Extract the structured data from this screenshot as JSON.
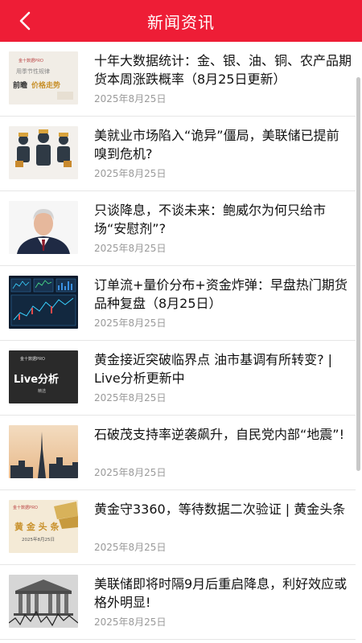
{
  "header": {
    "title": "新闻资讯",
    "back_icon": "chevron-left-icon",
    "color": "#ee1d36"
  },
  "news": [
    {
      "title": "十年大数据统计：金、银、油、铜、农产品期货本周涨跌概率（8月25日更新）",
      "date": "2025年8月25日",
      "thumb": {
        "brand": "金十数据PRO",
        "line1": "用季节性规律",
        "line2": "前瞻",
        "line3": "价格走势"
      }
    },
    {
      "title": "美就业市场陷入“诡异”僵局，美联储已提前嗅到危机?",
      "date": "2025年8月25日"
    },
    {
      "title": "只谈降息，不谈未来：鲍威尔为何只给市场“安慰剂”?",
      "date": "2025年8月25日"
    },
    {
      "title": "订单流+量价分布+资金炸弹：早盘热门期货品种复盘（8月25日）",
      "date": "2025年8月25日"
    },
    {
      "title": "黄金接近突破临界点 油市基调有所转变? | Live分析更新中",
      "date": "2025年8月25日",
      "thumb": {
        "brand": "金十数据PRO",
        "main": "Live分析",
        "sub": "精选"
      }
    },
    {
      "title": "石破茂支持率逆袭飙升，自民党内部“地震”!",
      "date": "2025年8月25日"
    },
    {
      "title": "黄金守3360，等待数据二次验证 | 黄金头条",
      "date": "2025年8月25日",
      "thumb": {
        "brand": "金十数据PRO",
        "main": "黄 金 头 条",
        "sub": "2025年8月25日"
      }
    },
    {
      "title": "美联储即将时隔9月后重启降息，利好效应或格外明显!",
      "date": "2025年8月25日"
    }
  ]
}
